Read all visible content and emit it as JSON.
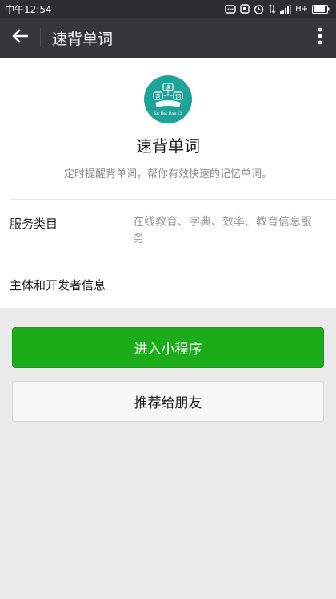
{
  "status_bar": {
    "time": "中午12:54",
    "network": "H+"
  },
  "app_bar": {
    "title": "速背单词",
    "back_icon": "arrow-left-icon",
    "more_icon": "more-vertical-icon"
  },
  "profile": {
    "logo_text_top": "速",
    "logo_text_left": "背",
    "logo_text_right": "词",
    "logo_caption": "Su Bei Dan Ci",
    "name": "速背单词",
    "description": "定时提醒背单词，帮你有效快速的记忆单词。"
  },
  "info": {
    "service_label": "服务类目",
    "service_value": "在线教育、字典、效率、教育信息服务",
    "developer_label": "主体和开发者信息"
  },
  "actions": {
    "enter_label": "进入小程序",
    "share_label": "推荐给朋友"
  },
  "colors": {
    "primary": "#1aad19",
    "appbar": "#37373b",
    "logo": "#1ea398"
  }
}
